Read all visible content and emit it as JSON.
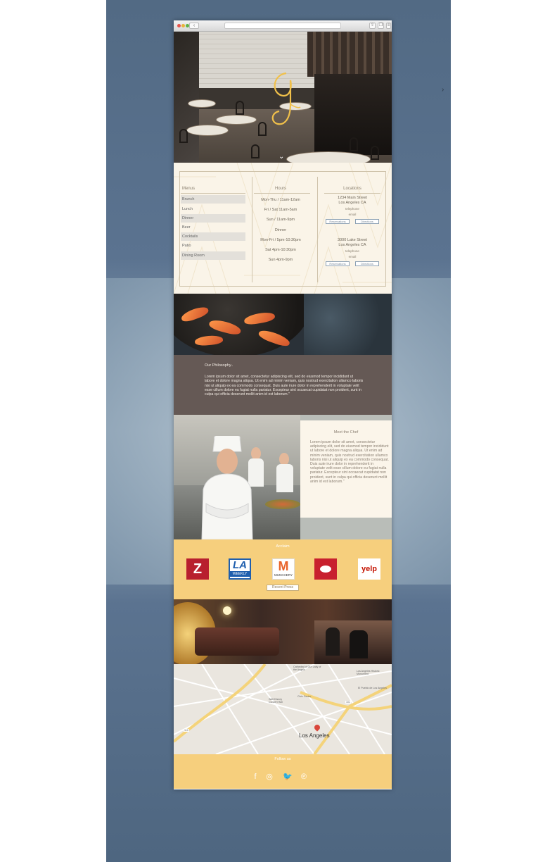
{
  "colors": {
    "backdrop": "#526a84",
    "info_bg": "#faf4e8",
    "philosophy_bg": "#655955",
    "accent_gold": "#f6cf7d",
    "logo_gold": "#f0c04a"
  },
  "browser": {
    "back_glyph": "‹",
    "share_icon": "share-icon",
    "tabs_icon": "tabs-icon"
  },
  "hero": {
    "logo_icon": "restaurant-monogram-logo",
    "scroll_icon": "chevron-down-icon"
  },
  "info": {
    "menus": {
      "title": "Menus",
      "items": [
        "Brunch",
        "Lunch",
        "Dinner",
        "Beer",
        "Cocktails",
        "Patio",
        "Dining Room"
      ]
    },
    "hours": {
      "title": "Hours",
      "lines": [
        "Mon-Thu / 11am-12am",
        "Fri / Sat 11am-5am",
        "Sun / 11am-9pm",
        "Dinner",
        "Mon-Fri / 5pm-10:30pm",
        "Sat 4pm-10:30pm",
        "Sun 4pm-9pm"
      ]
    },
    "locations": {
      "title": "Locations",
      "list": [
        {
          "street": "1234 Main Street",
          "city": "Los Angeles CA",
          "phone": "telephone",
          "email": "email",
          "reserve": "Reservations",
          "directions": "Directions"
        },
        {
          "street": "3000 Lake Street",
          "city": "Los Angeles CA",
          "phone": "telephone",
          "email": "email",
          "reserve": "Reservations",
          "directions": "Directions"
        }
      ]
    }
  },
  "philosophy": {
    "title": "Our Philosophy..",
    "body": "Lorem ipsum dolor sit amet, consectetur adipiscing elit, sed do eiusmod tempor incididunt ut labore et dolore magna aliqua. Ut enim ad minim veniam, quis nostrud exercitation ullamco laboris nisi ut aliquip ex ea commodo consequat. Duis aute irure dolor in reprehenderit in voluptate velit esse cillum dolore eu fugiat nulla pariatur. Excepteur sint occaecat cupidatat non proident, sunt in culpa qui officia deserunt mollit anim id est laborum.\""
  },
  "chef": {
    "title": "Meet the Chef",
    "body": "Lorem ipsum dolor sit amet, consectetur adipiscing elit, sed do eiusmod tempor incididunt ut labore et dolore magna aliqua. Ut enim ad minim veniam, quis nostrud exercitation ullamco laboris nisi ut aliquip ex ea commodo consequat. Duis aute irure dolor in reprehenderit in voluptate velit esse cillum dolore eu fugiat nulla pariatur. Excepteur sint occaecat cupidatat non proident, sunt in culpa qui officia deserunt mollit anim id est laborum.\""
  },
  "acclaim": {
    "title": "Acclaim",
    "logos": [
      {
        "icon": "zagat-logo-icon",
        "text": "Z",
        "color": "#b81f2e"
      },
      {
        "icon": "la-weekly-logo-icon",
        "text": "LA",
        "sub": "WEEKLY",
        "color": "#1f5fae"
      },
      {
        "icon": "munchery-logo-icon",
        "text": "M",
        "sub": "MUNCHERY",
        "color": "#e8632a"
      },
      {
        "icon": "eater-logo-icon",
        "text": "",
        "color": "#c8202e"
      },
      {
        "icon": "yelp-logo-icon",
        "text": "yelp",
        "color": "#c41200"
      }
    ],
    "press_button": "Recent Press"
  },
  "map": {
    "city": "Los Angeles",
    "labels": [
      "Cathedral of Our Lady of the Angels",
      "Walt Disney Concert Hall",
      "Los Angeles Historic Monument",
      "Civic Center",
      "El Pueblo de Los Angeles",
      "101",
      "110"
    ]
  },
  "footer": {
    "follow": "Follow us",
    "social": [
      {
        "icon": "facebook-icon",
        "glyph": "f"
      },
      {
        "icon": "instagram-icon",
        "glyph": "◎"
      },
      {
        "icon": "twitter-icon",
        "glyph": "🐦"
      },
      {
        "icon": "pinterest-icon",
        "glyph": "℗"
      }
    ]
  }
}
